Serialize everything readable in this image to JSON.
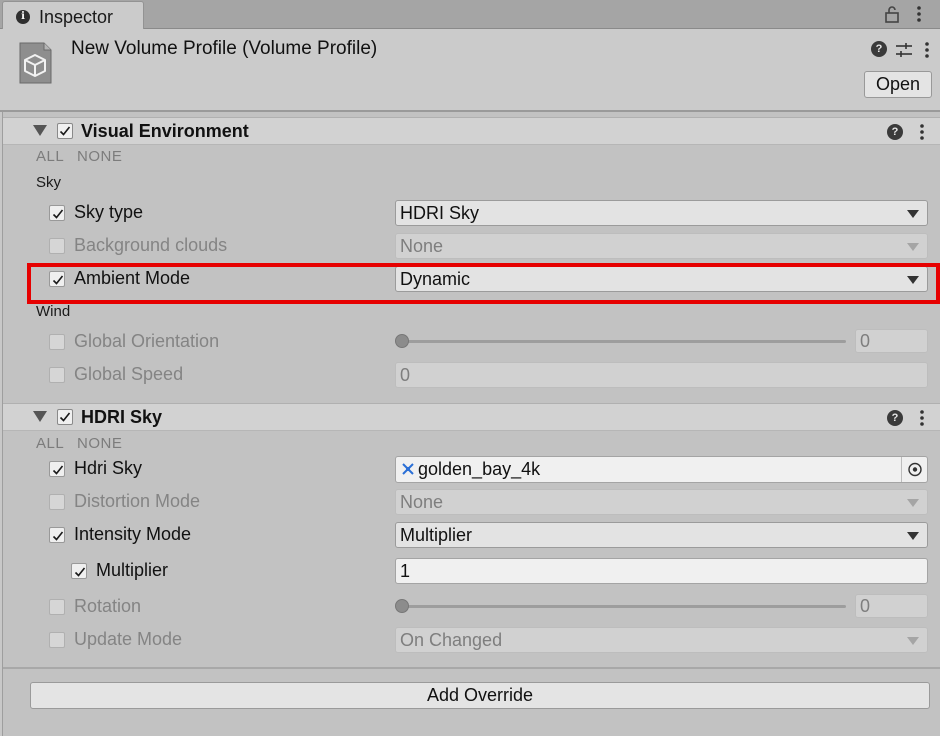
{
  "window": {
    "tab_label": "Inspector",
    "tab_icon": "info-icon",
    "lock_icon": "lock-icon",
    "menu_icon": "kebab-icon"
  },
  "header": {
    "title": "New Volume Profile (Volume Profile)",
    "asset_icon": "volume-profile-cube-icon",
    "help_icon": "help-icon",
    "preset_icon": "preset-sliders-icon",
    "menu_icon": "kebab-icon",
    "open_label": "Open"
  },
  "sections": [
    {
      "title": "Visual Environment",
      "enabled": true,
      "all_label": "ALL",
      "none_label": "NONE",
      "groups": [
        {
          "heading": "Sky",
          "properties": [
            {
              "label": "Sky type",
              "overridden": true,
              "control": "dropdown",
              "value": "HDRI Sky"
            },
            {
              "label": "Background clouds",
              "overridden": false,
              "control": "dropdown",
              "value": "None"
            },
            {
              "label": "Ambient Mode",
              "overridden": true,
              "control": "dropdown",
              "value": "Dynamic",
              "highlighted": true
            }
          ]
        },
        {
          "heading": "Wind",
          "properties": [
            {
              "label": "Global Orientation",
              "overridden": false,
              "control": "slider",
              "value": "0",
              "slider_fraction": 0
            },
            {
              "label": "Global Speed",
              "overridden": false,
              "control": "field",
              "value": "0"
            }
          ]
        }
      ]
    },
    {
      "title": "HDRI Sky",
      "enabled": true,
      "all_label": "ALL",
      "none_label": "NONE",
      "properties": [
        {
          "label": "Hdri Sky",
          "overridden": true,
          "control": "object",
          "value": "golden_bay_4k",
          "value_icon": "cubemap-icon",
          "picker_icon": "object-picker-icon"
        },
        {
          "label": "Distortion Mode",
          "overridden": false,
          "control": "dropdown",
          "value": "None"
        },
        {
          "label": "Intensity Mode",
          "overridden": true,
          "control": "dropdown",
          "value": "Multiplier"
        },
        {
          "label": "Multiplier",
          "overridden": true,
          "control": "field",
          "value": "1",
          "indented": true
        },
        {
          "label": "Rotation",
          "overridden": false,
          "control": "slider",
          "value": "0",
          "slider_fraction": 0
        },
        {
          "label": "Update Mode",
          "overridden": false,
          "control": "dropdown",
          "value": "On Changed"
        }
      ]
    }
  ],
  "footer": {
    "add_override_label": "Add Override"
  },
  "colors": {
    "highlight": "#e60000",
    "panel": "#c2c2c2",
    "header": "#cbcbcb"
  }
}
